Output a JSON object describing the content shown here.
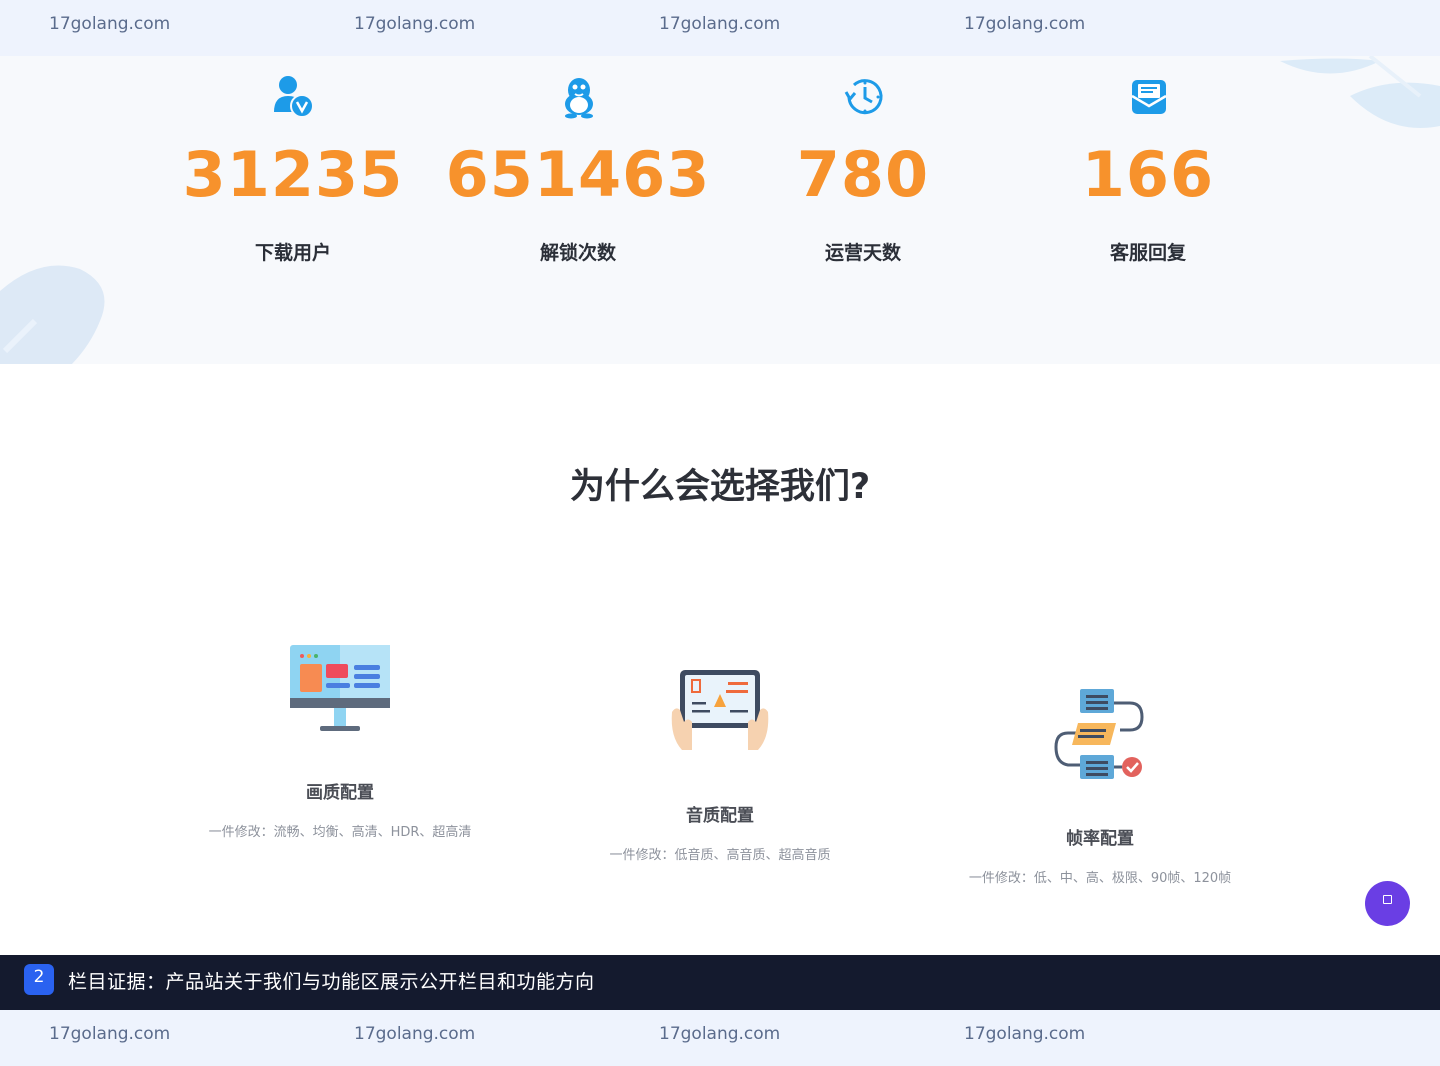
{
  "watermark": {
    "text_top": [
      "17golang.com",
      "17golang.com",
      "17golang.com",
      "17golang.com"
    ],
    "text_bottom": [
      "17golang.com",
      "17golang.com",
      "17golang.com",
      "17golang.com"
    ]
  },
  "stats": [
    {
      "icon": "user-verified-icon",
      "value": "31235",
      "label": "下载用户"
    },
    {
      "icon": "qq-penguin-icon",
      "value": "651463",
      "label": "解锁次数"
    },
    {
      "icon": "clock-history-icon",
      "value": "780",
      "label": "运营天数"
    },
    {
      "icon": "mail-envelope-icon",
      "value": "166",
      "label": "客服回复"
    }
  ],
  "why": {
    "title": "为什么会选择我们?"
  },
  "features": [
    {
      "icon": "monitor-icon",
      "title": "画质配置",
      "desc": "一件修改：流畅、均衡、高清、HDR、超高清"
    },
    {
      "icon": "tablet-hands-icon",
      "title": "音质配置",
      "desc": "一件修改：低音质、高音质、超高音质"
    },
    {
      "icon": "workflow-icon",
      "title": "帧率配置",
      "desc": "一件修改：低、中、高、极限、90帧、120帧"
    }
  ],
  "evidence": {
    "badge": "2",
    "text": "栏目证据：产品站关于我们与功能区展示公开栏目和功能方向"
  },
  "colors": {
    "accent_orange": "#f7922c",
    "icon_blue": "#1d9be8",
    "fab_purple": "#6a3ee4",
    "evidence_bg": "#141a2e"
  }
}
